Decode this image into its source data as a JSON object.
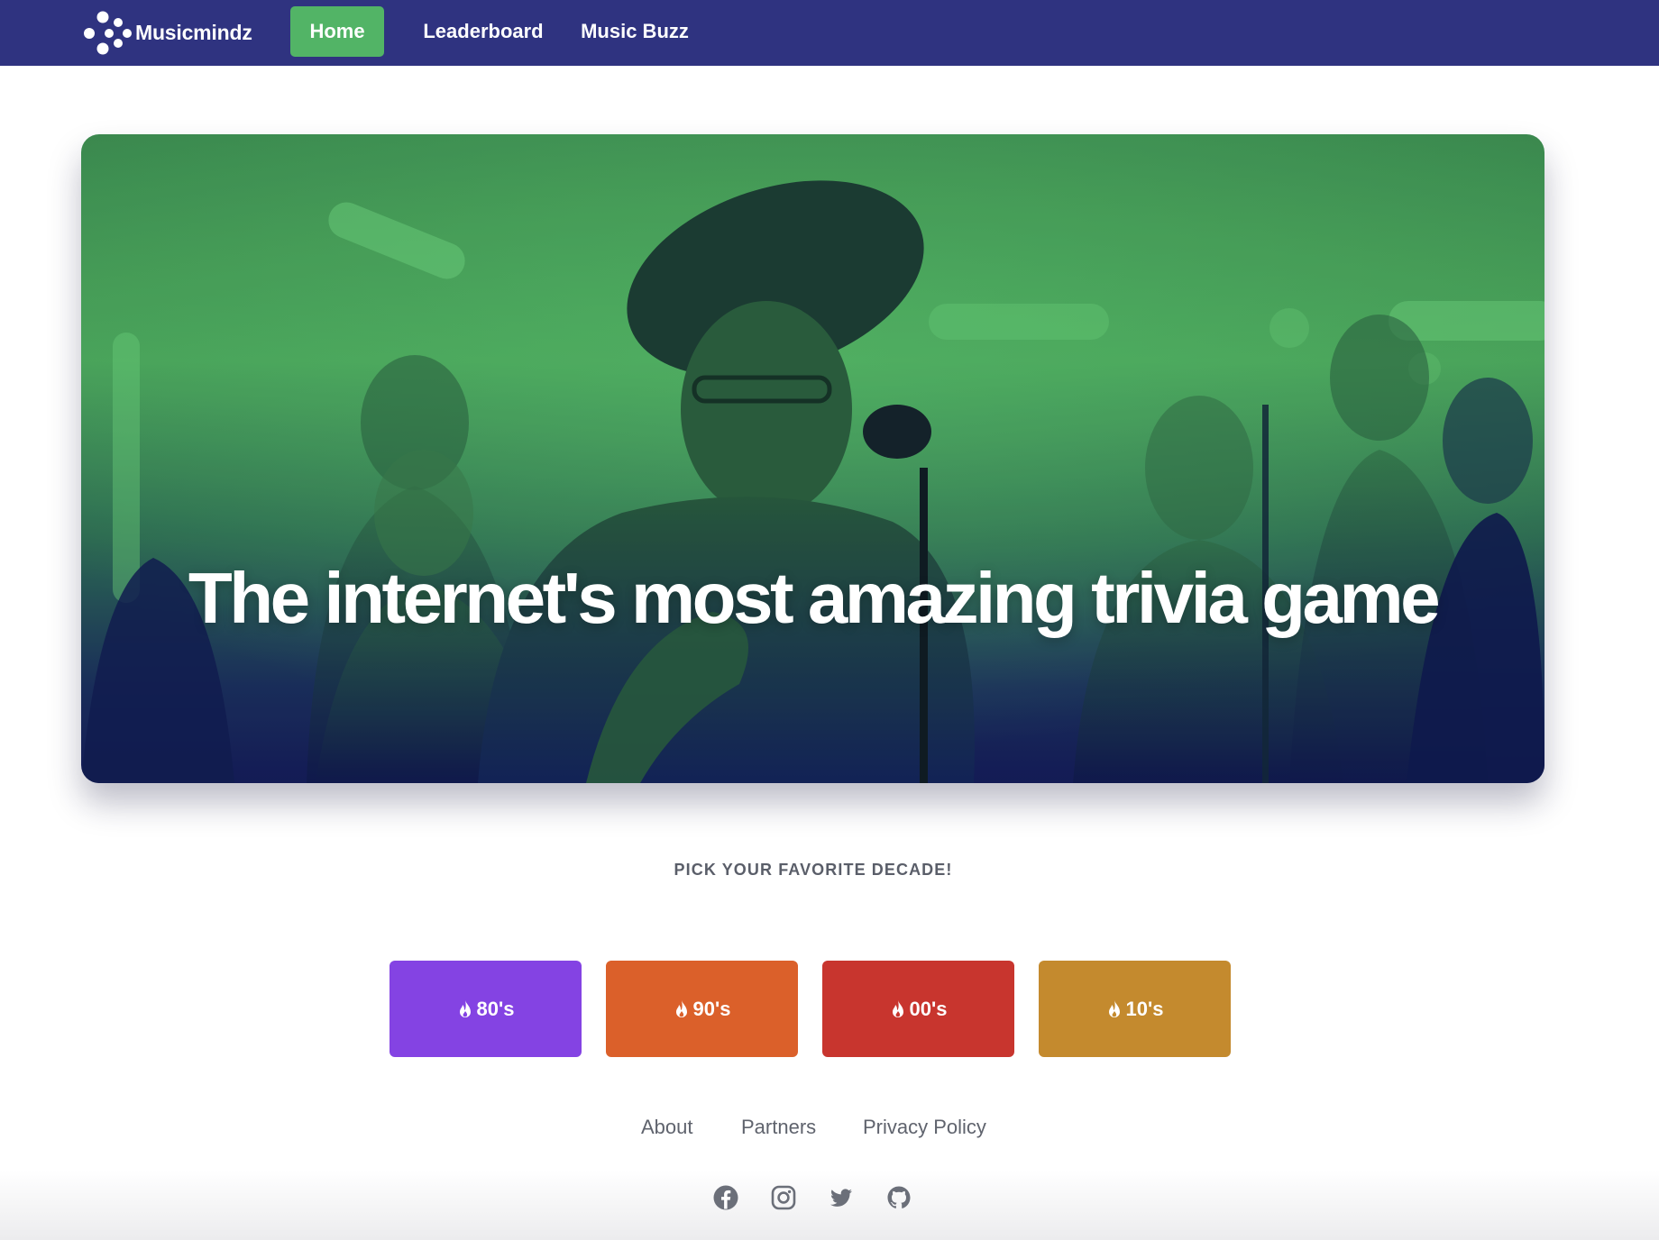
{
  "navbar": {
    "brand_name": "Musicmindz",
    "brand_logo_icon": "dots-logo-icon",
    "links": [
      {
        "label": "Home",
        "active": true
      },
      {
        "label": "Leaderboard",
        "active": false
      },
      {
        "label": "Music Buzz",
        "active": false
      }
    ]
  },
  "hero": {
    "title": "The internet's most amazing trivia game",
    "image": "singer-with-hat-at-microphone-green-duotone-photo"
  },
  "decades": {
    "heading": "PICK YOUR FAVORITE DECADE!",
    "icon": "fire-icon",
    "buttons": [
      {
        "label": "80's",
        "color": "#8443e3"
      },
      {
        "label": "90's",
        "color": "#db602a"
      },
      {
        "label": "00's",
        "color": "#c8352e"
      },
      {
        "label": "10's",
        "color": "#c48a2e"
      }
    ]
  },
  "footer": {
    "links": [
      "About",
      "Partners",
      "Privacy Policy"
    ],
    "social_icons": [
      "facebook-icon",
      "instagram-icon",
      "twitter-icon",
      "github-icon"
    ]
  },
  "colors": {
    "navbar_bg": "#2f3380",
    "active_nav": "#52b466",
    "hero_green": "#4fae5f",
    "hero_navy": "#15185a"
  }
}
